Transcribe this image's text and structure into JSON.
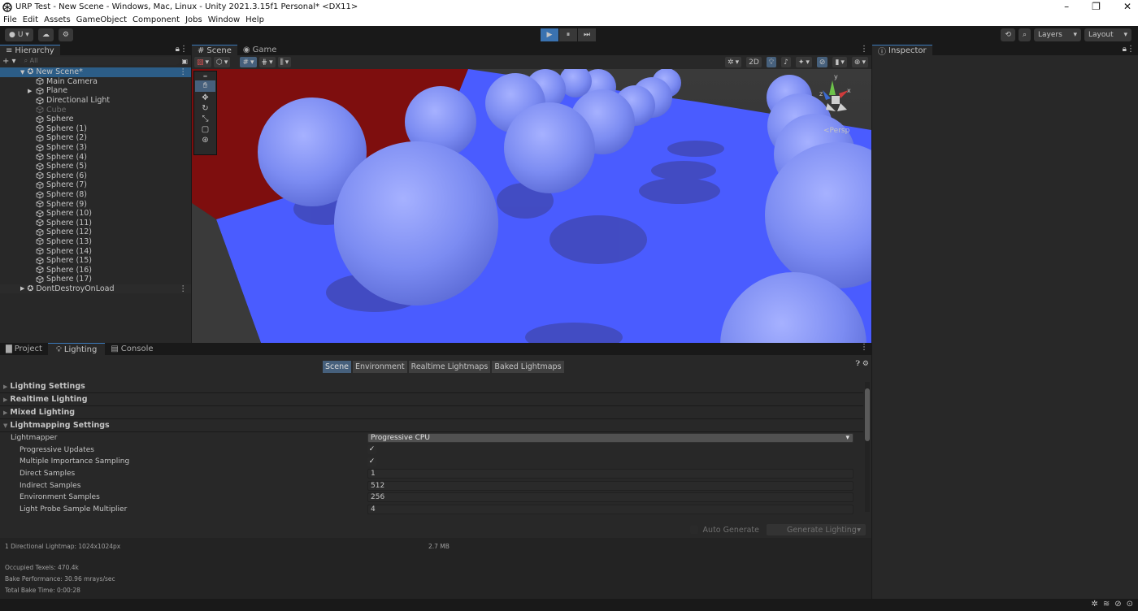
{
  "window": {
    "title": "URP Test - New Scene - Windows, Mac, Linux - Unity 2021.3.15f1 Personal* <DX11>",
    "controls": {
      "minimize": "–",
      "restore": "❐",
      "close": "✕"
    }
  },
  "menu": [
    "File",
    "Edit",
    "Assets",
    "GameObject",
    "Component",
    "Jobs",
    "Window",
    "Help"
  ],
  "toolbar": {
    "account_label": "U ▾",
    "cloud": "☁",
    "play": "▶",
    "pause": "⏸",
    "step": "⏭",
    "layers_label": "Layers",
    "layout_label": "Layout"
  },
  "hierarchy": {
    "tab": "Hierarchy",
    "search_placeholder": "All",
    "add": "+ ▾",
    "scene_name": "New Scene*",
    "items": [
      "Main Camera",
      "Plane",
      "Directional Light",
      "Cube",
      "Sphere",
      "Sphere (1)",
      "Sphere (2)",
      "Sphere (3)",
      "Sphere (4)",
      "Sphere (5)",
      "Sphere (6)",
      "Sphere (7)",
      "Sphere (8)",
      "Sphere (9)",
      "Sphere (10)",
      "Sphere (11)",
      "Sphere (12)",
      "Sphere (13)",
      "Sphere (14)",
      "Sphere (15)",
      "Sphere (16)",
      "Sphere (17)"
    ],
    "dont_destroy": "DontDestroyOnLoad"
  },
  "scene_view": {
    "tabs": [
      "Scene",
      "Game"
    ],
    "mode_2d": "2D",
    "persp": "<Persp",
    "gizmo_axes": {
      "y": "y",
      "x": "x",
      "z": "z"
    }
  },
  "inspector": {
    "tab": "Inspector"
  },
  "bottom": {
    "tabs": [
      "Project",
      "Lighting",
      "Console"
    ],
    "segments": [
      "Scene",
      "Environment",
      "Realtime Lightmaps",
      "Baked Lightmaps"
    ],
    "sections": [
      "Lighting Settings",
      "Realtime Lighting",
      "Mixed Lighting",
      "Lightmapping Settings"
    ],
    "lightmapper_label": "Lightmapper",
    "lightmapper_value": "Progressive CPU",
    "props": [
      {
        "label": "Progressive Updates",
        "value": "✓"
      },
      {
        "label": "Multiple Importance Sampling",
        "value": "✓"
      },
      {
        "label": "Direct Samples",
        "value": "1"
      },
      {
        "label": "Indirect Samples",
        "value": "512"
      },
      {
        "label": "Environment Samples",
        "value": "256"
      },
      {
        "label": "Light Probe Sample Multiplier",
        "value": "4"
      }
    ],
    "auto_generate": "Auto Generate",
    "generate_lighting": "Generate Lighting",
    "stats": {
      "line1": "1 Directional Lightmap: 1024x1024px",
      "size": "2.7 MB",
      "occupied": "Occupied Texels: 470.4k",
      "performance": "Bake Performance: 30.96 mrays/sec",
      "time": "Total Bake Time: 0:00:28"
    }
  },
  "colors": {
    "accent": "#3a72b0",
    "wall": "#8a1010",
    "floor": "#4a5cff",
    "sphere": "#7f8ef0"
  }
}
